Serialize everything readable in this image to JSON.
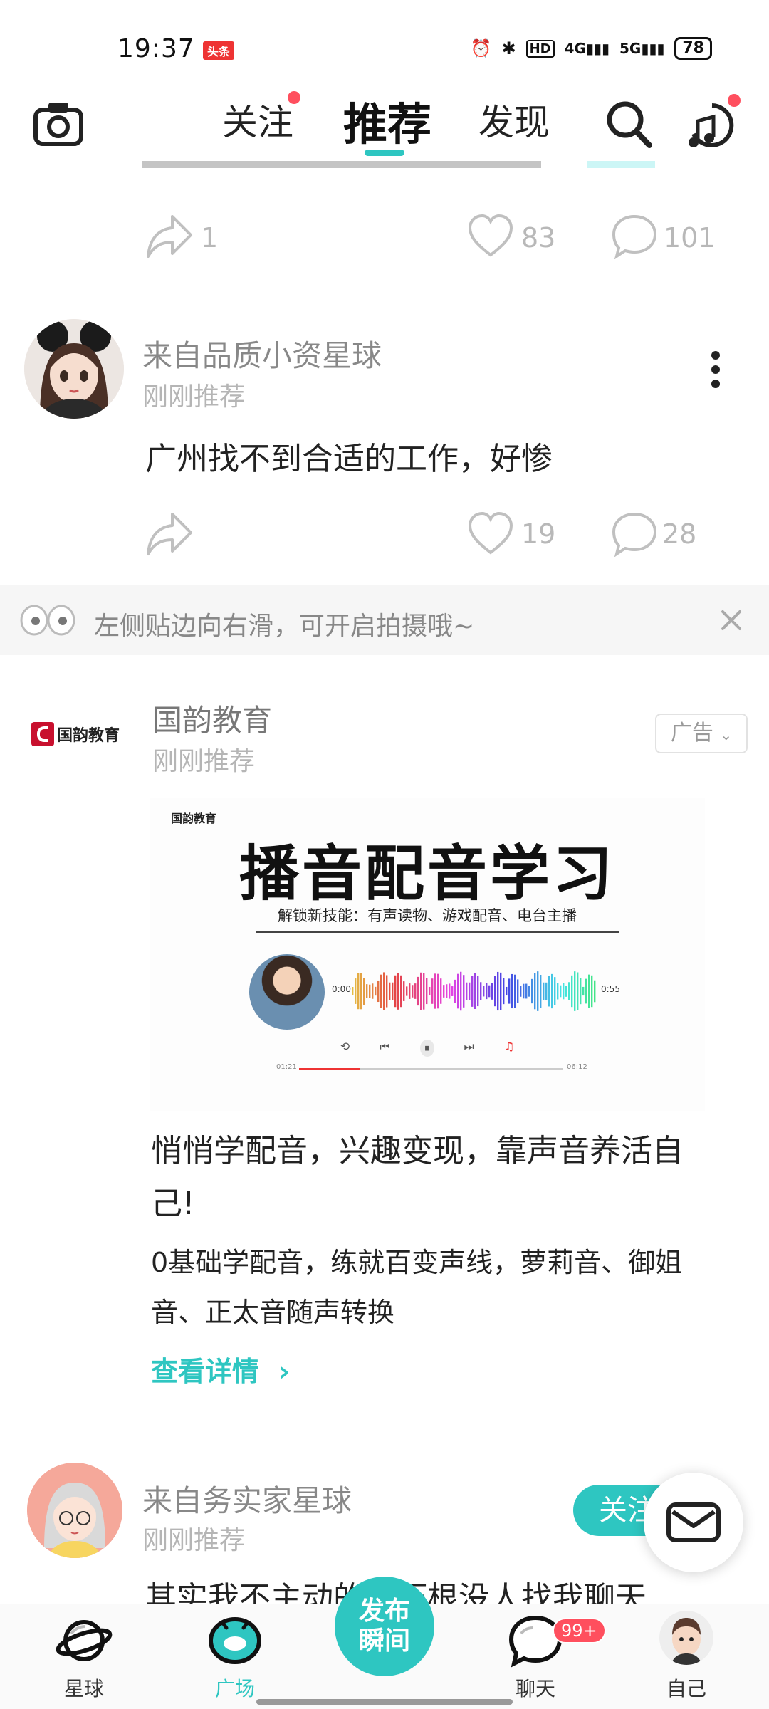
{
  "status_bar": {
    "time": "19:37",
    "app_badge": "头条",
    "network": "4G",
    "network2": "5G",
    "hd": "HD",
    "battery": "78"
  },
  "header": {
    "tabs": [
      {
        "label": "关注"
      },
      {
        "label": "推荐"
      },
      {
        "label": "发现"
      }
    ]
  },
  "prev_post": {
    "share_count": "1",
    "like_count": "83",
    "comment_count": "101"
  },
  "post1": {
    "source": "来自品质小资星球",
    "time": "刚刚推荐",
    "text": "广州找不到合适的工作，好惨",
    "like_count": "19",
    "comment_count": "28"
  },
  "tip_banner": {
    "text": "左侧贴边向右滑，可开启拍摄哦~"
  },
  "ad": {
    "brand": "国韵教育",
    "logo_text": "国韵教育",
    "time": "刚刚推荐",
    "tag": "广告",
    "image": {
      "brand_small": "国韵教育",
      "headline": "播音配音学习",
      "subline": "解锁新技能：有声读物、游戏配音、电台主播",
      "time_left": "0:00",
      "time_right": "0:55",
      "progress_left": "01:21",
      "progress_right": "06:12",
      "progress": 0.23
    },
    "title": "悄悄学配音，兴趣变现，靠声音养活自己!",
    "description": "0基础学配音，练就百变声线，萝莉音、御姐音、正太音随声转换",
    "cta": "查看详情"
  },
  "post2": {
    "source": "来自务实家星球",
    "time": "刚刚推荐",
    "follow_label": "关注",
    "text": "其实我不主动的，压根没人找我聊天"
  },
  "bottom_nav": {
    "items": [
      {
        "label": "星球"
      },
      {
        "label": "广场"
      },
      {
        "label": "聊天"
      },
      {
        "label": "自己"
      }
    ],
    "publish_line1": "发布",
    "publish_line2": "瞬间",
    "chat_badge": "99+"
  },
  "colors": {
    "accent": "#2ec6c1",
    "badge": "#ff4f5e"
  }
}
